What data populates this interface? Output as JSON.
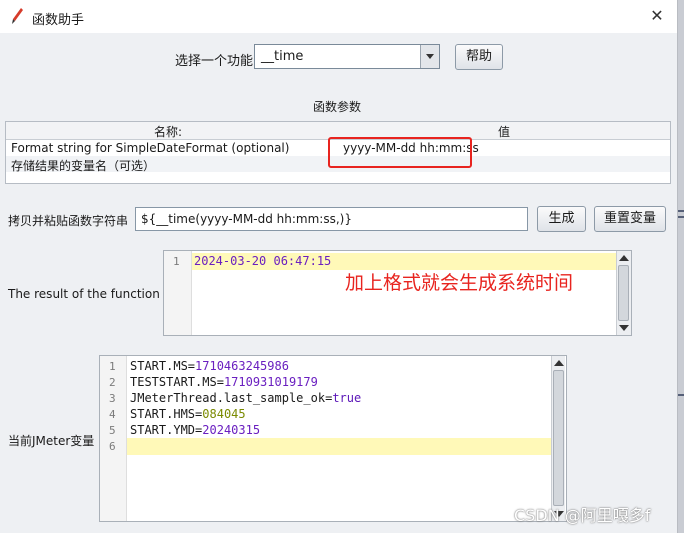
{
  "window": {
    "title": "函数助手",
    "close_symbol": "✕"
  },
  "function_select": {
    "label": "选择一个功能",
    "value": "__time",
    "help_label": "帮助"
  },
  "params": {
    "section_title": "函数参数",
    "col_name": "名称:",
    "col_value": "值",
    "rows": [
      {
        "name": "Format string for SimpleDateFormat (optional)",
        "value": "yyyy-MM-dd hh:mm:ss"
      },
      {
        "name": "存储结果的变量名（可选）",
        "value": ""
      }
    ]
  },
  "function_string": {
    "label": "拷贝并粘贴函数字符串",
    "value": "${__time(yyyy-MM-dd hh:mm:ss,)}",
    "generate_label": "生成",
    "reset_label": "重置变量"
  },
  "result": {
    "label": "The result of the function is",
    "line_number": "1",
    "text": "2024-03-20 06:47:15"
  },
  "annotation": "加上格式就会生成系统时间",
  "vars": {
    "label": "当前JMeter变量",
    "lines": [
      {
        "n": "1",
        "key": "START.MS",
        "value": "1710463245986",
        "type": "num"
      },
      {
        "n": "2",
        "key": "TESTSTART.MS",
        "value": "1710931019179",
        "type": "num"
      },
      {
        "n": "3",
        "key": "JMeterThread.last_sample_ok",
        "value": "true",
        "type": "bool"
      },
      {
        "n": "4",
        "key": "START.HMS",
        "value": "084045",
        "type": "str"
      },
      {
        "n": "5",
        "key": "START.YMD",
        "value": "20240315",
        "type": "num"
      },
      {
        "n": "6",
        "key": "",
        "value": "",
        "type": ""
      }
    ]
  },
  "watermark": "CSDN @阿里嘎多f",
  "colors": {
    "annotation_red": "#e8241f",
    "highlight_line": "#fff9b8",
    "number_purple": "#6a1fc0"
  }
}
